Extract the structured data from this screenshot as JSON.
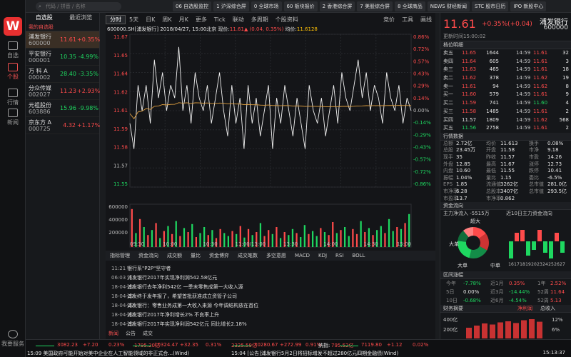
{
  "nav": {
    "items": [
      {
        "label": "自选"
      },
      {
        "label": "个股"
      },
      {
        "label": "行情"
      },
      {
        "label": "新闻"
      }
    ],
    "bottom": "我要服务"
  },
  "top": {
    "search_placeholder": "代码 / 拼音 / 名称",
    "tabs": [
      "06 自选股监控",
      "1 沪深综合屏",
      "0 全球市场",
      "60 板块报价",
      "2 香港综合屏",
      "7 美股综合屏",
      "8 全球商品",
      "NEWS 财经新闻",
      "STC 股市日历",
      "IPO 新股中心"
    ]
  },
  "list": {
    "tab_watch": "自选股",
    "tab_recent": "最近浏览",
    "group": "我的自选股",
    "stocks": [
      {
        "name": "浦发银行",
        "code": "600000",
        "price": "11.61",
        "pct": "+0.35%",
        "dir": "red",
        "sel": true
      },
      {
        "name": "平安银行",
        "code": "000001",
        "price": "10.35",
        "pct": "-4.99%",
        "dir": "grn"
      },
      {
        "name": "万 科 A",
        "code": "000002",
        "price": "28.40",
        "pct": "-3.35%",
        "dir": "grn"
      },
      {
        "name": "分众传媒",
        "code": "002027",
        "price": "11.23",
        "pct": "+2.93%",
        "dir": "red"
      },
      {
        "name": "元祖股份",
        "code": "603886",
        "price": "15.96",
        "pct": "-9.98%",
        "dir": "grn"
      },
      {
        "name": "京东方 A",
        "code": "000725",
        "price": "4.32",
        "pct": "+1.17%",
        "dir": "red"
      }
    ]
  },
  "chart": {
    "tabs": [
      "分时",
      "5天",
      "日K",
      "周K",
      "月K",
      "更多",
      "Tick",
      "联动",
      "多周期",
      "个股资料"
    ],
    "right_tabs": [
      "竞价",
      "工具",
      "画线"
    ],
    "info": {
      "head": "600000.SH[浦发银行]  2018/04/27, 15:00北京  现价:",
      "cur": "11.61",
      "arrow": "▲",
      "chg": "(0.04, 0.35%)",
      "avg_label": "  均价:",
      "avg": "11.6128"
    },
    "indicators": [
      "指标管理",
      "资金流向",
      "成交额",
      "量比",
      "资金博弈",
      "成交笔数",
      "多空意愿",
      "MACD",
      "KDJ",
      "RSI",
      "BOLL"
    ]
  },
  "chart_data": {
    "type": "line",
    "title": "",
    "x_ticks": [
      "09:30",
      "10:00",
      "10:30",
      "11:00/13:00",
      "13:30",
      "14:00",
      "14:30",
      "15:00"
    ],
    "y_ticks": [
      "11.67",
      "11.65",
      "11.64",
      "11.62",
      "11.61",
      "11.59",
      "11.58",
      "11.57",
      "11.55"
    ],
    "pct_ticks": [
      "0.86%",
      "0.72%",
      "0.57%",
      "0.43%",
      "0.29%",
      "0.14%",
      "0.00%",
      "-0.14%",
      "-0.29%",
      "-0.43%",
      "-0.57%",
      "-0.72%",
      "-0.86%"
    ],
    "ylim": [
      11.55,
      11.67
    ],
    "pre_close": 11.57,
    "avg_price": 11.6128,
    "vol_ticks": [
      "600000",
      "400000",
      "200000"
    ],
    "series": [
      {
        "values": [
          11.6,
          11.58,
          11.63,
          11.61,
          11.63,
          11.6,
          11.65,
          11.62,
          11.64,
          11.61,
          11.63,
          11.62,
          11.66,
          11.61,
          11.63,
          11.6,
          11.64,
          11.62,
          11.61,
          11.63,
          11.6,
          11.62,
          11.64,
          11.61,
          11.59,
          11.63,
          11.6,
          11.62,
          11.58,
          11.63,
          11.6,
          11.62,
          11.59,
          11.61,
          11.63,
          11.58,
          11.62,
          11.6,
          11.63,
          11.61,
          11.59,
          11.62,
          11.6,
          11.58,
          11.63,
          11.61,
          11.6,
          11.62,
          11.59,
          11.61,
          11.63,
          11.6,
          11.64,
          11.62,
          11.61,
          11.63,
          11.65,
          11.62,
          11.64,
          11.61,
          11.63,
          11.62,
          11.6,
          11.64,
          11.62,
          11.61,
          11.63,
          11.6,
          11.62,
          11.61
        ]
      }
    ],
    "volume": [
      380,
      140,
      280,
      200,
      120,
      170,
      240,
      90,
      160,
      210,
      130,
      260,
      110,
      190,
      150,
      230,
      100,
      140,
      200,
      120,
      170,
      90,
      180,
      140,
      110,
      160,
      130,
      210,
      95,
      180,
      120,
      150,
      240,
      110,
      170,
      130,
      200,
      90,
      150,
      120,
      180,
      140,
      100,
      220,
      130,
      160,
      110,
      190,
      150,
      120,
      250,
      140,
      170,
      200,
      110,
      180,
      130,
      260,
      150,
      190,
      120,
      170,
      210,
      140,
      280,
      160,
      200,
      180,
      240,
      330
    ]
  },
  "news": [
    {
      "d": "11:21",
      "t": "银行系\"P2P\"坚守者"
    },
    {
      "d": "06:03",
      "t": "浦发银行2017年实现净利润542.58亿元"
    },
    {
      "d": "18-04-27",
      "t": "浦发银行去年净利542亿 一季末零售成第一大收入源"
    },
    {
      "d": "18-04-27",
      "t": "浦发终于发年报了，希望首批获准成立资管子公司"
    },
    {
      "d": "18-04-27",
      "t": "浦发银行：零售业务成第一大收入来源 今年调结构放在首位"
    },
    {
      "d": "18-04-27",
      "t": "浦发银行2017年净利增长2% 不良率上升"
    },
    {
      "d": "18-04-27",
      "t": "浦发银行2017年实现净利润542亿元 同比增长2.18%"
    }
  ],
  "news_tabs": [
    "新闻",
    "公告",
    "成交"
  ],
  "quote": {
    "name": "浦发银行",
    "code": "600000",
    "price": "11.61",
    "change": "+0.35%(+0.04)",
    "time": "更新时间15:00:02",
    "orderbook_title": "档位明细",
    "asks": [
      {
        "l": "卖五",
        "p": "11.65",
        "v": "1644"
      },
      {
        "l": "卖四",
        "p": "11.64",
        "v": "605"
      },
      {
        "l": "卖三",
        "p": "11.63",
        "v": "465"
      },
      {
        "l": "卖二",
        "p": "11.62",
        "v": "378"
      },
      {
        "l": "卖一",
        "p": "11.61",
        "v": "94"
      }
    ],
    "bids": [
      {
        "l": "买一",
        "p": "11.60",
        "v": "579"
      },
      {
        "l": "买二",
        "p": "11.59",
        "v": "741"
      },
      {
        "l": "买三",
        "p": "11.58",
        "v": "1485"
      },
      {
        "l": "买四",
        "p": "11.57",
        "v": "1809"
      },
      {
        "l": "买五",
        "p": "11.56",
        "v": "2758"
      }
    ],
    "trades": [
      {
        "t": "14:59",
        "p": "11.61",
        "v": "32"
      },
      {
        "t": "14:59",
        "p": "11.61",
        "v": "3"
      },
      {
        "t": "14:59",
        "p": "11.61",
        "v": "18"
      },
      {
        "t": "14:59",
        "p": "11.62",
        "v": "19"
      },
      {
        "t": "14:59",
        "p": "11.62",
        "v": "8"
      },
      {
        "t": "14:59",
        "p": "11.61",
        "v": "9"
      },
      {
        "t": "14:59",
        "p": "11.60",
        "v": "4"
      },
      {
        "t": "14:59",
        "p": "11.61",
        "v": "2"
      },
      {
        "t": "14:59",
        "p": "11.62",
        "v": "568"
      },
      {
        "t": "14:59",
        "p": "11.61",
        "v": "2"
      }
    ],
    "stats_title": "行情数据",
    "stats": [
      [
        "总额",
        "2.72亿",
        "均价",
        "11.613",
        "换手",
        "0.08%"
      ],
      [
        "总股",
        "23.45万",
        "开盘",
        "11.58",
        "市净",
        "9.18"
      ],
      [
        "现手",
        "35",
        "昨收",
        "11.57",
        "市盈",
        "14.26"
      ],
      [
        "外盘",
        "12.85",
        "最高",
        "11.67",
        "涨停",
        "12.73"
      ],
      [
        "内盘",
        "10.60",
        "最低",
        "11.55",
        "跌停",
        "10.41"
      ],
      [
        "振幅",
        "1.04%",
        "量比",
        "1.15",
        "委比",
        "-6.5%"
      ]
    ],
    "stats2": [
      [
        "EPS",
        "1.85",
        "流通值",
        "3262亿",
        "总市值",
        "281.0亿"
      ],
      [
        "市净率",
        "6.28",
        "总股本",
        "3407亿",
        "总市值",
        "293.5亿"
      ],
      [
        "市盈率",
        "13.7",
        "市净率",
        "0.862",
        "",
        ""
      ]
    ],
    "flow_title": "资金流向",
    "flow_main": "主力净流入 -5515万",
    "flow_recent": "近10日主力资金流向",
    "donut": [
      {
        "label": "超大",
        "v": 15,
        "c": "#ff4b4b"
      },
      {
        "label": "大单",
        "v": 18,
        "c": "#cc3333"
      },
      {
        "label": "大单",
        "v": 21,
        "c": "#138d48"
      },
      {
        "label": "中单",
        "v": 23,
        "c": "#1ed760"
      },
      {
        "label": "小单",
        "v": 12,
        "c": "#0f6e3a"
      },
      {
        "label": "",
        "v": 11,
        "c": "#ff8080"
      }
    ],
    "flow_bars": [
      -6,
      3,
      4,
      -5,
      -3,
      4,
      -4,
      -6,
      3,
      -4
    ],
    "flow_labels": [
      "16",
      "17",
      "18",
      "19",
      "20",
      "23",
      "24",
      "25",
      "26",
      "27"
    ],
    "range_title": "区间涨幅",
    "ranges": [
      [
        "今年",
        "-7.78%",
        "近1月",
        "0.35%",
        "1年",
        "2.52%"
      ],
      [
        "5日",
        "0.00%",
        "近3月",
        "-14.44%",
        "52周",
        "11.64"
      ],
      [
        "10日",
        "-0.68%",
        "近6月",
        "-4.54%",
        "52周",
        "5.13"
      ]
    ],
    "fin_title": "财务摘要",
    "fin_tab1": "净利润",
    "fin_tab2": "总收入",
    "fin_labels": [
      "400亿",
      "200亿"
    ],
    "fin_pct": [
      "12%",
      "6%"
    ],
    "fin_bars": [
      0.5,
      0.6,
      0.7,
      0.65,
      0.75,
      0.8,
      0.72,
      0.85,
      0.9,
      0.78
    ]
  },
  "status": {
    "ticker": [
      [
        "3082.23",
        "+7.20",
        "0.23%",
        "1795.20亿"
      ],
      [
        "10324.47",
        "+32.35",
        "0.31%",
        "2325.59亿"
      ],
      [
        "30280.67",
        "+272.99",
        "0.91%",
        "795.52亿"
      ],
      [
        "7119.80",
        "+1.12",
        "0.02%"
      ]
    ],
    "news1": "15:09 美国政府可能开始对美中企业在人工智能领域的非正式合...(Wind)",
    "news2": "15:04 [公告]浦发银行5月2日将招标增发不超过280亿元四期金融债(Wind)",
    "clock": "15:13:37",
    "label1": "纳指:"
  }
}
